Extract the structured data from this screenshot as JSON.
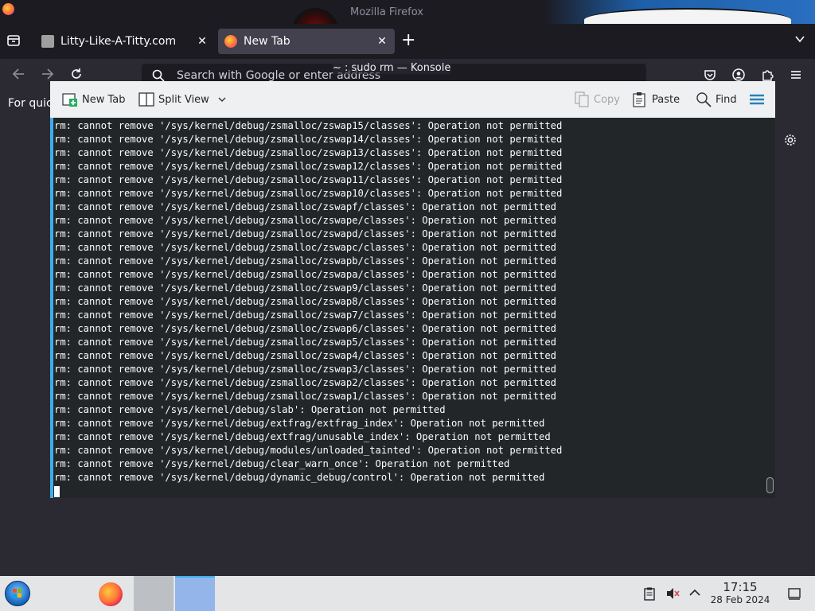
{
  "firefox": {
    "window_title": "Mozilla Firefox",
    "tabs": [
      {
        "label": "Litty-Like-A-Titty.com",
        "active": false
      },
      {
        "label": "New Tab",
        "active": true
      }
    ],
    "close_tab_glyph": "✕",
    "new_tab_glyph": "+",
    "list_tabs_glyph": "⌄",
    "url_placeholder": "Search with Google or enter address",
    "bookmarks_text": "For quic"
  },
  "konsole": {
    "window_title": "~ : sudo rm — Konsole",
    "toolbar": {
      "new_tab_label": "New Tab",
      "split_view_label": "Split View",
      "copy_label": "Copy",
      "paste_label": "Paste",
      "find_label": "Find"
    },
    "terminal_lines": [
      "rm: cannot remove '/sys/kernel/debug/zsmalloc/zswap15/classes': Operation not permitted",
      "rm: cannot remove '/sys/kernel/debug/zsmalloc/zswap14/classes': Operation not permitted",
      "rm: cannot remove '/sys/kernel/debug/zsmalloc/zswap13/classes': Operation not permitted",
      "rm: cannot remove '/sys/kernel/debug/zsmalloc/zswap12/classes': Operation not permitted",
      "rm: cannot remove '/sys/kernel/debug/zsmalloc/zswap11/classes': Operation not permitted",
      "rm: cannot remove '/sys/kernel/debug/zsmalloc/zswap10/classes': Operation not permitted",
      "rm: cannot remove '/sys/kernel/debug/zsmalloc/zswapf/classes': Operation not permitted",
      "rm: cannot remove '/sys/kernel/debug/zsmalloc/zswape/classes': Operation not permitted",
      "rm: cannot remove '/sys/kernel/debug/zsmalloc/zswapd/classes': Operation not permitted",
      "rm: cannot remove '/sys/kernel/debug/zsmalloc/zswapc/classes': Operation not permitted",
      "rm: cannot remove '/sys/kernel/debug/zsmalloc/zswapb/classes': Operation not permitted",
      "rm: cannot remove '/sys/kernel/debug/zsmalloc/zswapa/classes': Operation not permitted",
      "rm: cannot remove '/sys/kernel/debug/zsmalloc/zswap9/classes': Operation not permitted",
      "rm: cannot remove '/sys/kernel/debug/zsmalloc/zswap8/classes': Operation not permitted",
      "rm: cannot remove '/sys/kernel/debug/zsmalloc/zswap7/classes': Operation not permitted",
      "rm: cannot remove '/sys/kernel/debug/zsmalloc/zswap6/classes': Operation not permitted",
      "rm: cannot remove '/sys/kernel/debug/zsmalloc/zswap5/classes': Operation not permitted",
      "rm: cannot remove '/sys/kernel/debug/zsmalloc/zswap4/classes': Operation not permitted",
      "rm: cannot remove '/sys/kernel/debug/zsmalloc/zswap3/classes': Operation not permitted",
      "rm: cannot remove '/sys/kernel/debug/zsmalloc/zswap2/classes': Operation not permitted",
      "rm: cannot remove '/sys/kernel/debug/zsmalloc/zswap1/classes': Operation not permitted",
      "rm: cannot remove '/sys/kernel/debug/slab': Operation not permitted",
      "rm: cannot remove '/sys/kernel/debug/extfrag/extfrag_index': Operation not permitted",
      "rm: cannot remove '/sys/kernel/debug/extfrag/unusable_index': Operation not permitted",
      "rm: cannot remove '/sys/kernel/debug/modules/unloaded_tainted': Operation not permitted",
      "rm: cannot remove '/sys/kernel/debug/clear_warn_once': Operation not permitted",
      "rm: cannot remove '/sys/kernel/debug/dynamic_debug/control': Operation not permitted"
    ]
  },
  "taskbar": {
    "clock_time": "17:15",
    "clock_date": "28 Feb 2024"
  },
  "colors": {
    "terminal_bg": "#232629",
    "terminal_fg": "#fcfcfc",
    "accent": "#3daee9",
    "firefox_chrome": "#1c1b22"
  }
}
